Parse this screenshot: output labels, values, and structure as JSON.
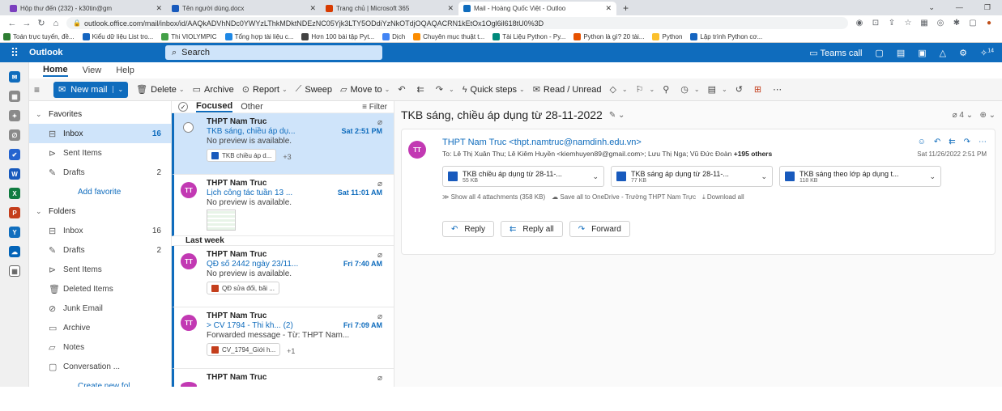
{
  "browser": {
    "tabs": [
      {
        "label": "Hộp thư đến (232) - k30tin@gm",
        "color": "#7b3fbe",
        "active": false
      },
      {
        "label": "Tên người dùng.docx",
        "color": "#185abd",
        "active": false
      },
      {
        "label": "Trang chủ | Microsoft 365",
        "color": "#d83b01",
        "active": false
      },
      {
        "label": "Mail - Hoàng Quốc Việt - Outloo",
        "color": "#0f6cbd",
        "active": true
      }
    ],
    "url": "outlook.office.com/mail/inbox/id/AAQkADVhNDc0YWYzLThkMDktNDEzNC05Yjk3LTY5ODdiYzNkOTdjOQAQACRN1kEtOx1Ogl6il618tU0%3D",
    "bookmarks": [
      {
        "label": "Toán trực tuyến, đề...",
        "color": "#2e7d32"
      },
      {
        "label": "Kiểu dữ liệu List tro...",
        "color": "#1565c0"
      },
      {
        "label": "Thi VIOLYMPIC",
        "color": "#43a047"
      },
      {
        "label": "Tổng hợp tài liệu c...",
        "color": "#1e88e5"
      },
      {
        "label": "Hơn 100 bài tập Pyt...",
        "color": "#424242"
      },
      {
        "label": "Dịch",
        "color": "#4285f4"
      },
      {
        "label": "Chuyên mục thuật t...",
        "color": "#fb8c00"
      },
      {
        "label": "Tài Liệu Python - Py...",
        "color": "#00897b"
      },
      {
        "label": "Python là gì? 20 tài...",
        "color": "#e65100"
      },
      {
        "label": "Python",
        "color": "#fbc02d"
      },
      {
        "label": "Lập trình Python cơ...",
        "color": "#1565c0"
      }
    ]
  },
  "suite": {
    "app_name": "Outlook",
    "search_placeholder": "Search",
    "teams_call": "Teams call",
    "badge": "14"
  },
  "ribbon": {
    "tabs": [
      "Home",
      "View",
      "Help"
    ],
    "new_mail": "New mail",
    "delete": "Delete",
    "archive": "Archive",
    "report": "Report",
    "sweep": "Sweep",
    "move_to": "Move to",
    "quick_steps": "Quick steps",
    "read_unread": "Read / Unread"
  },
  "folders": {
    "favorites_label": "Favorites",
    "favorites": [
      {
        "label": "Inbox",
        "count": "16",
        "icon": "inbox-icon",
        "selected": true
      },
      {
        "label": "Sent Items",
        "count": "",
        "icon": "send-icon",
        "selected": false
      },
      {
        "label": "Drafts",
        "count": "2",
        "icon": "pencil-icon",
        "selected": false
      }
    ],
    "add_favorite": "Add favorite",
    "folders_label": "Folders",
    "items": [
      {
        "label": "Inbox",
        "count": "16",
        "icon": "inbox-icon"
      },
      {
        "label": "Drafts",
        "count": "2",
        "icon": "pencil-icon"
      },
      {
        "label": "Sent Items",
        "count": "",
        "icon": "send-icon"
      },
      {
        "label": "Deleted Items",
        "count": "",
        "icon": "trash-icon"
      },
      {
        "label": "Junk Email",
        "count": "",
        "icon": "junk-icon"
      },
      {
        "label": "Archive",
        "count": "",
        "icon": "archive-icon"
      },
      {
        "label": "Notes",
        "count": "",
        "icon": "note-icon"
      },
      {
        "label": "Conversation ...",
        "count": "",
        "icon": "folder-icon"
      }
    ],
    "create_new": "Create new fol..."
  },
  "list": {
    "focused": "Focused",
    "other": "Other",
    "filter": "Filter",
    "messages_top": [
      {
        "sender": "THPT Nam Truc",
        "subject": "TKB sáng, chiều áp dụ...",
        "time": "Sat 2:51 PM",
        "preview": "No preview is available.",
        "chip": "TKB chiều áp d...",
        "more": "+3",
        "selected": true,
        "avatar": ""
      },
      {
        "sender": "THPT Nam Truc",
        "subject": "Lịch công tác tuần 13 ...",
        "time": "Sat 11:01 AM",
        "preview": "No preview is available.",
        "chip": "",
        "more": "",
        "selected": false,
        "avatar": "TT"
      }
    ],
    "group_last_week": "Last week",
    "messages_week": [
      {
        "sender": "THPT Nam Truc",
        "subject": "QĐ số 2442 ngày 23/11...",
        "time": "Fri 7:40 AM",
        "preview": "No preview is available.",
        "chip": "QĐ sửa đổi, bãi ...",
        "more": "",
        "avatar": "TT"
      },
      {
        "sender": "THPT Nam Truc",
        "subject": "> CV 1794 - Thi kh...  (2)",
        "time": "Fri 7:09 AM",
        "preview": "Forwarded message - Từ: THPT Nam...",
        "chip": "CV_1794_Giới h...",
        "more": "+1",
        "avatar": "TT"
      },
      {
        "sender": "THPT Nam Truc",
        "subject": "",
        "time": "",
        "preview": "",
        "chip": "",
        "more": "",
        "avatar": ""
      }
    ]
  },
  "reading": {
    "subject": "TKB sáng, chiều áp dụng từ 28-11-2022",
    "count": "4",
    "avatar": "TT",
    "from": "THPT Nam Truc <thpt.namtruc@namdinh.edu.vn>",
    "to_prefix": "To: Lê Thị Xuân Thu;  Lê Kiêm Huyền <kiemhuyen89@gmail.com>;  Lưu Thị Nga;  Vũ Đức Đoàn ",
    "to_others": "+195 others",
    "date": "Sat 11/26/2022 2:51 PM",
    "attachments": [
      {
        "name": "TKB chiều áp dụng từ 28-11-...",
        "size": "55 KB"
      },
      {
        "name": "TKB sáng áp dụng từ 28-11-...",
        "size": "77 KB"
      },
      {
        "name": "TKB sáng theo lớp áp dụng t...",
        "size": "118 KB"
      }
    ],
    "show_all": "Show all 4 attachments (358 KB)",
    "save_onedrive": "Save all to OneDrive - Trường THPT Nam Trực",
    "download_all": "Download all",
    "reply": "Reply",
    "reply_all": "Reply all",
    "forward": "Forward"
  },
  "colors": {
    "accent": "#0f6cbd",
    "selected": "#cfe4fa",
    "avatar": "#c239b3"
  }
}
